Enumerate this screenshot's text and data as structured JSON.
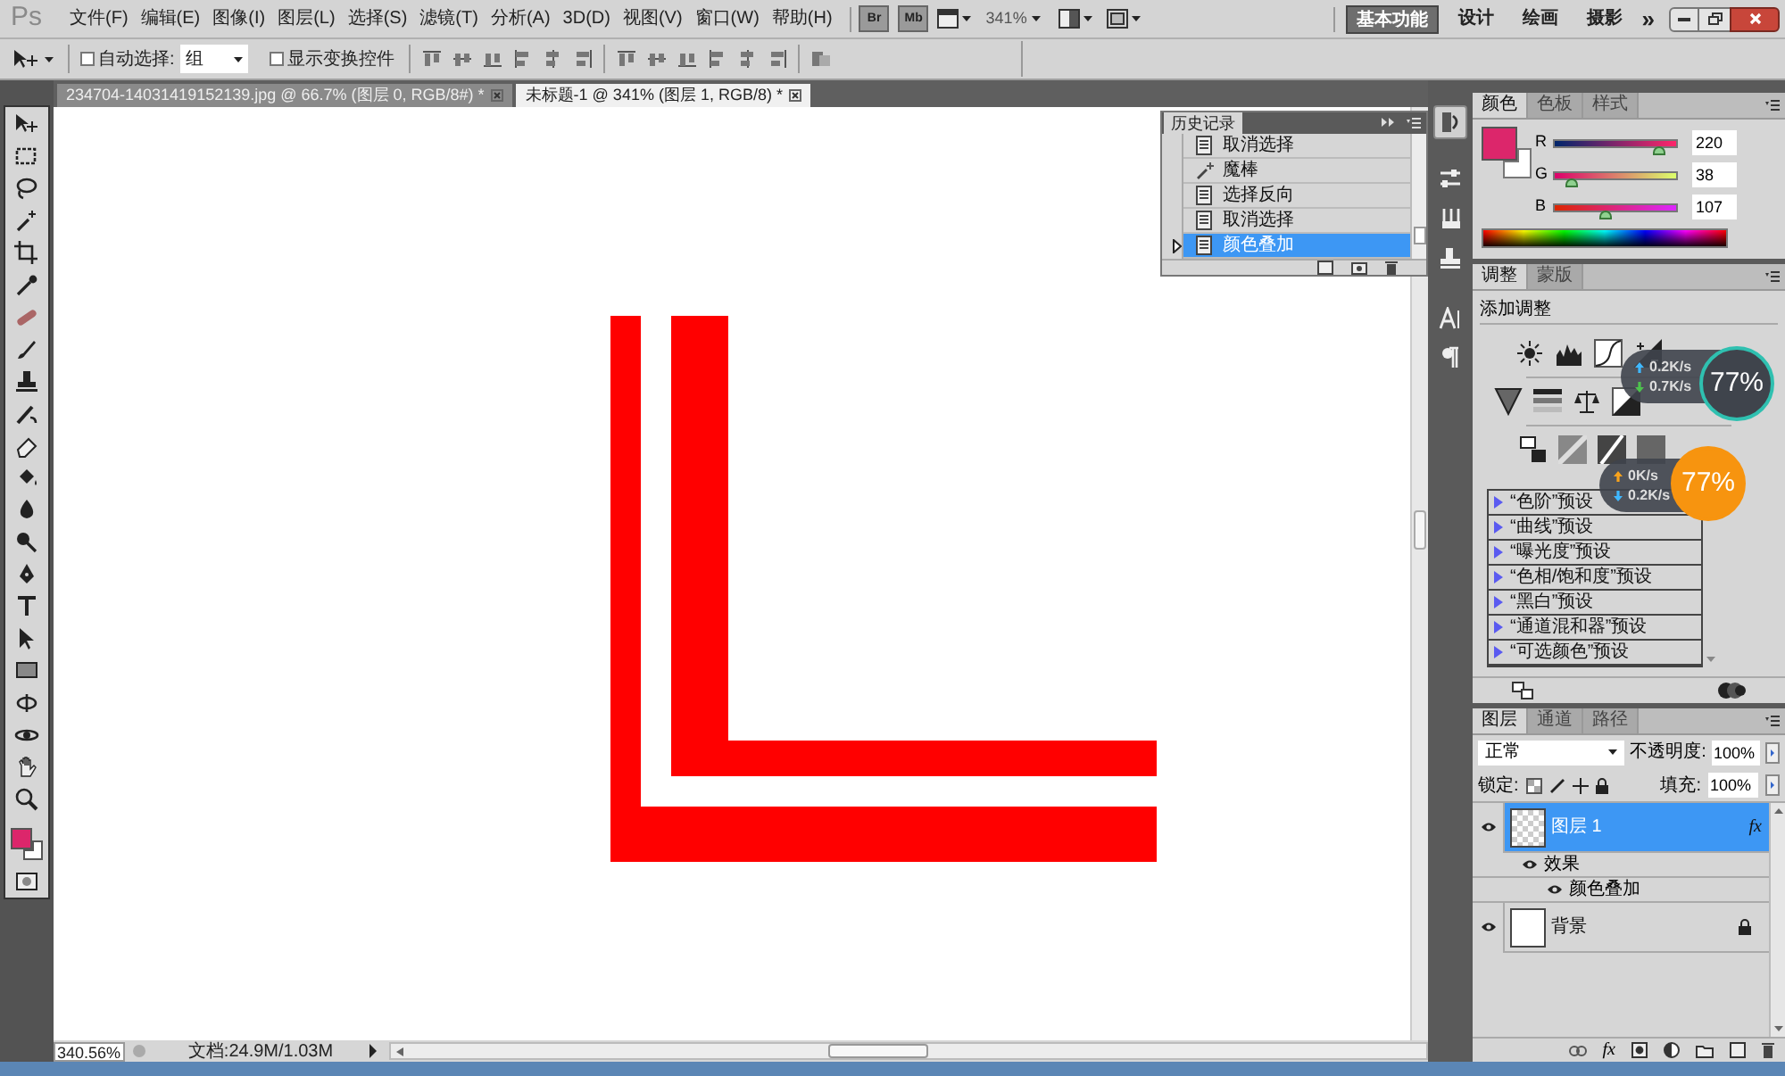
{
  "app_logo": "Ps",
  "menu": [
    "文件(F)",
    "编辑(E)",
    "图像(I)",
    "图层(L)",
    "选择(S)",
    "滤镜(T)",
    "分析(A)",
    "3D(D)",
    "视图(V)",
    "窗口(W)",
    "帮助(H)"
  ],
  "bridge_buttons": [
    "Br",
    "Mb"
  ],
  "zoom_menu": "341%",
  "workspaces": [
    {
      "label": "基本功能",
      "selected": true
    },
    {
      "label": "设计",
      "selected": false
    },
    {
      "label": "绘画",
      "selected": false
    },
    {
      "label": "摄影",
      "selected": false
    }
  ],
  "more_workspaces": "»",
  "options_bar": {
    "auto_select": {
      "label": "自动选择:",
      "checked": false
    },
    "auto_select_target": "组",
    "show_transform": {
      "label": "显示变换控件",
      "checked": false
    }
  },
  "document_tabs": [
    {
      "label": "234704-14031419152139.jpg @ 66.7% (图层 0, RGB/8#) *",
      "selected": false
    },
    {
      "label": "未标题-1 @ 341% (图层 1, RGB/8) *",
      "selected": true
    }
  ],
  "history_panel": {
    "title": "历史记录",
    "items": [
      {
        "label": "取消选择",
        "kind": "step",
        "selected": false
      },
      {
        "label": "魔棒",
        "kind": "wand",
        "selected": false
      },
      {
        "label": "选择反向",
        "kind": "step",
        "selected": false
      },
      {
        "label": "取消选择",
        "kind": "step",
        "selected": false
      },
      {
        "label": "颜色叠加",
        "kind": "step",
        "selected": true
      }
    ]
  },
  "color_panel": {
    "tabs": [
      {
        "label": "颜色",
        "selected": true
      },
      {
        "label": "色板",
        "selected": false
      },
      {
        "label": "样式",
        "selected": false
      }
    ],
    "channels": [
      {
        "name": "R",
        "value": "220",
        "level": 0.863
      },
      {
        "name": "G",
        "value": "38",
        "level": 0.149
      },
      {
        "name": "B",
        "value": "107",
        "level": 0.42
      }
    ]
  },
  "adjustments_panel": {
    "tabs": [
      {
        "label": "调整",
        "selected": true
      },
      {
        "label": "蒙版",
        "selected": false
      }
    ],
    "heading": "添加调整",
    "presets": [
      "“色阶”预设",
      "“曲线”预设",
      "“曝光度”预设",
      "“色相/饱和度”预设",
      "“黑白”预设",
      "“通道混和器”预设",
      "“可选颜色”预设"
    ]
  },
  "layers_panel": {
    "tabs": [
      {
        "label": "图层",
        "selected": true
      },
      {
        "label": "通道",
        "selected": false
      },
      {
        "label": "路径",
        "selected": false
      }
    ],
    "blend_mode": "正常",
    "opacity_label": "不透明度:",
    "opacity": "100%",
    "lock_label": "锁定:",
    "fill_label": "填充:",
    "fill": "100%",
    "layers": [
      {
        "name": "图层 1",
        "selected": true,
        "visible": true,
        "locked": false,
        "fx_badge": "fx",
        "effects_label": "效果",
        "effects": [
          "颜色叠加"
        ]
      },
      {
        "name": "背景",
        "selected": false,
        "visible": true,
        "locked": true
      }
    ],
    "footer_fx": "fx"
  },
  "status_bar": {
    "zoom": "340.56%",
    "document_info": "文档:24.9M/1.03M"
  },
  "speed_widgets": [
    {
      "kind": "dark",
      "upload": "0.2K/s",
      "download": "0.7K/s",
      "percent": "77%"
    },
    {
      "kind": "orange",
      "upload": "0K/s",
      "download": "0.2K/s",
      "percent": "77%"
    }
  ]
}
